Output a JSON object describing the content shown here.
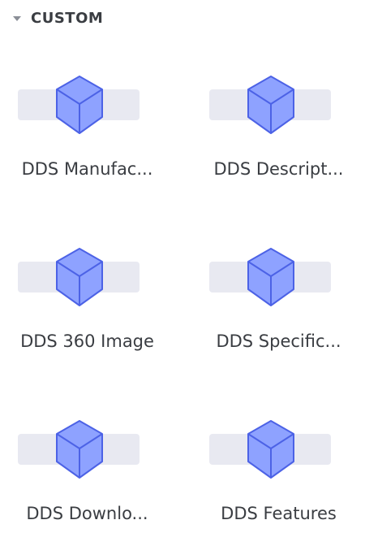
{
  "section": {
    "title": "CUSTOM",
    "caret_icon": "caret-down-icon"
  },
  "widgets": [
    {
      "label": "DDS Manufac...",
      "icon": "cube-icon"
    },
    {
      "label": "DDS Descript...",
      "icon": "cube-icon"
    },
    {
      "label": "DDS 360 Image",
      "icon": "cube-icon"
    },
    {
      "label": "DDS Specific...",
      "icon": "cube-icon"
    },
    {
      "label": "DDS Downlo...",
      "icon": "cube-icon"
    },
    {
      "label": "DDS Features",
      "icon": "cube-icon"
    }
  ],
  "colors": {
    "cube_fill": "#8ea2ff",
    "cube_stroke": "#4c62e6",
    "tile_bar": "#e8e9f1",
    "text": "#3a3d42"
  }
}
